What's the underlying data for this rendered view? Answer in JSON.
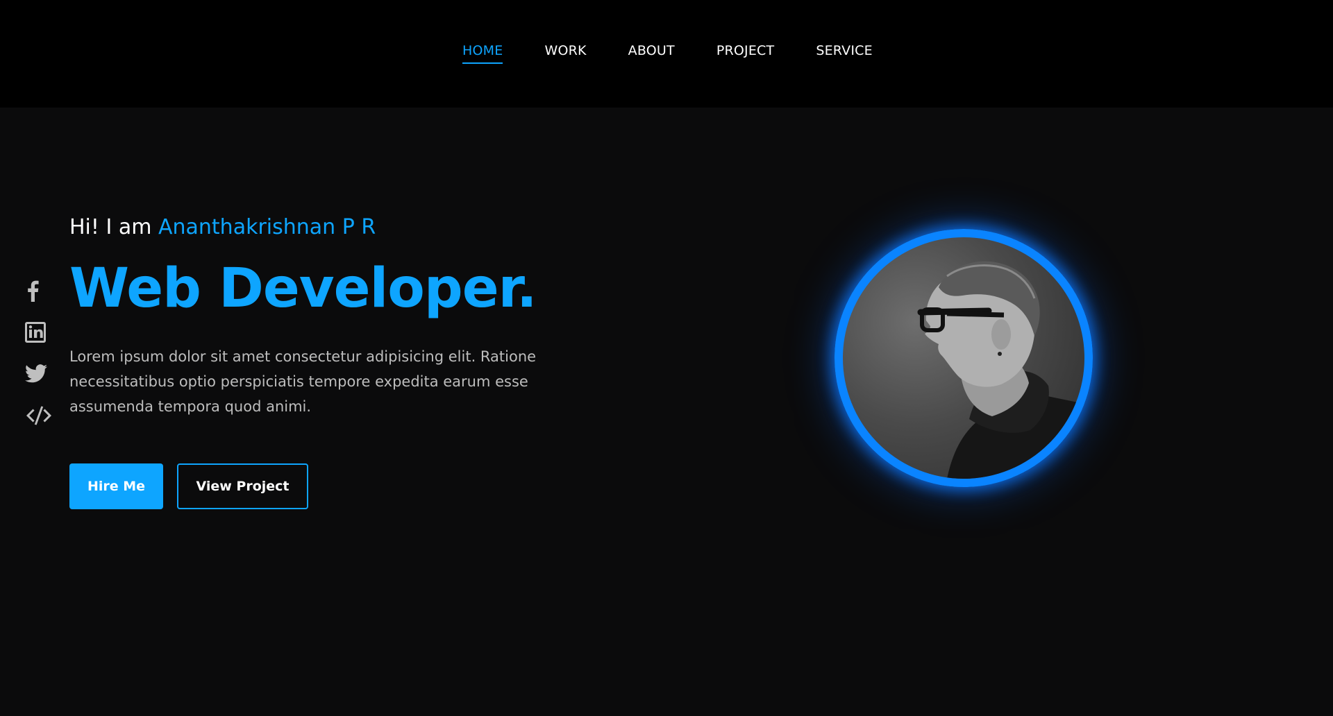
{
  "nav": {
    "items": [
      {
        "label": "HOME",
        "active": true
      },
      {
        "label": "WORK",
        "active": false
      },
      {
        "label": "ABOUT",
        "active": false
      },
      {
        "label": "PROJECT",
        "active": false
      },
      {
        "label": "SERVICE",
        "active": false
      }
    ]
  },
  "social": {
    "icons": [
      "facebook-icon",
      "linkedin-icon",
      "twitter-icon",
      "code-icon"
    ],
    "icon_color": "#bfbfbf"
  },
  "hero": {
    "greeting_prefix": "Hi! I am ",
    "name": "Ananthakrishnan P R",
    "role": "Web Developer.",
    "description": "Lorem ipsum dolor sit amet consectetur adipisicing elit. Ratione necessitatibus optio perspiciatis tempore expedita earum esse assumenda tempora quod animi.",
    "hire_label": "Hire Me",
    "view_label": "View Project"
  },
  "colors": {
    "accent": "#0ea5ff",
    "ring": "#0a84ff",
    "background": "#0b0b0c",
    "nav_background": "#000000"
  }
}
